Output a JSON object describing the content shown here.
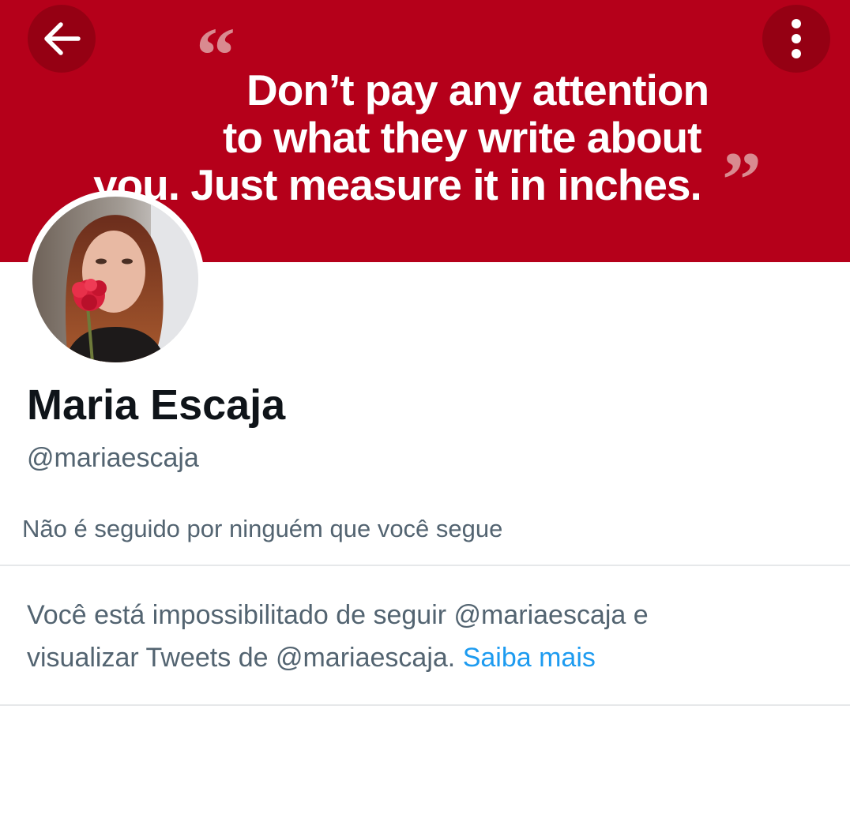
{
  "banner": {
    "quote_lines": [
      "Don’t pay any attention",
      "to what they write about",
      "you. Just measure it in inches."
    ],
    "quote_open_mark": "“",
    "quote_close_mark": "”",
    "background_color": "#b5001a"
  },
  "toolbar": {
    "back_icon": "arrow-left-icon",
    "more_icon": "more-vertical-icon"
  },
  "profile": {
    "display_name": "Maria Escaja",
    "handle": "@mariaescaja",
    "followed_by_text": "Não é seguido por ninguém que você segue"
  },
  "blocked_notice": {
    "line1": "Você está impossibilitado de seguir @mariaescaja e",
    "line2": "visualizar Tweets de @mariaescaja.",
    "learn_more": "Saiba mais"
  },
  "colors": {
    "primary_text": "#0f1419",
    "secondary_text": "#536471",
    "link": "#1d9bf0"
  }
}
